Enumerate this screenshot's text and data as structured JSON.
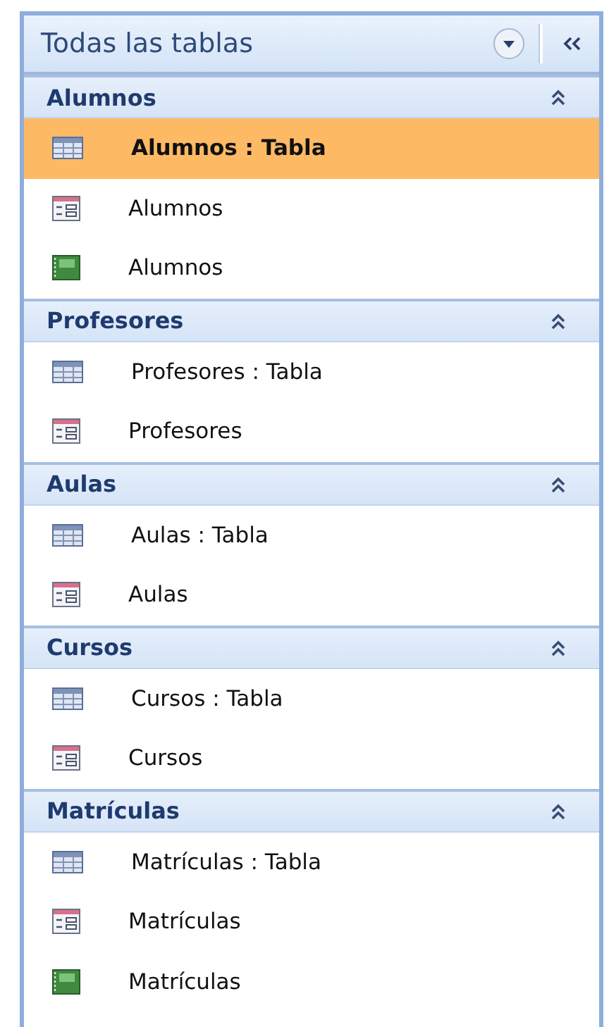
{
  "pane": {
    "title": "Todas las tablas"
  },
  "groups": [
    {
      "name": "Alumnos",
      "expanded": true,
      "items": [
        {
          "kind": "table",
          "label": "Alumnos : Tabla",
          "selected": true
        },
        {
          "kind": "form",
          "label": "Alumnos",
          "selected": false
        },
        {
          "kind": "report",
          "label": "Alumnos",
          "selected": false
        }
      ]
    },
    {
      "name": "Profesores",
      "expanded": true,
      "items": [
        {
          "kind": "table",
          "label": "Profesores : Tabla",
          "selected": false
        },
        {
          "kind": "form",
          "label": "Profesores",
          "selected": false
        }
      ]
    },
    {
      "name": "Aulas",
      "expanded": true,
      "items": [
        {
          "kind": "table",
          "label": "Aulas : Tabla",
          "selected": false
        },
        {
          "kind": "form",
          "label": "Aulas",
          "selected": false
        }
      ]
    },
    {
      "name": "Cursos",
      "expanded": true,
      "items": [
        {
          "kind": "table",
          "label": "Cursos : Tabla",
          "selected": false
        },
        {
          "kind": "form",
          "label": "Cursos",
          "selected": false
        }
      ]
    },
    {
      "name": "Matrículas",
      "expanded": true,
      "items": [
        {
          "kind": "table",
          "label": "Matrículas : Tabla",
          "selected": false
        },
        {
          "kind": "form",
          "label": "Matrículas",
          "selected": false
        },
        {
          "kind": "report",
          "label": "Matrículas",
          "selected": false
        }
      ]
    }
  ]
}
